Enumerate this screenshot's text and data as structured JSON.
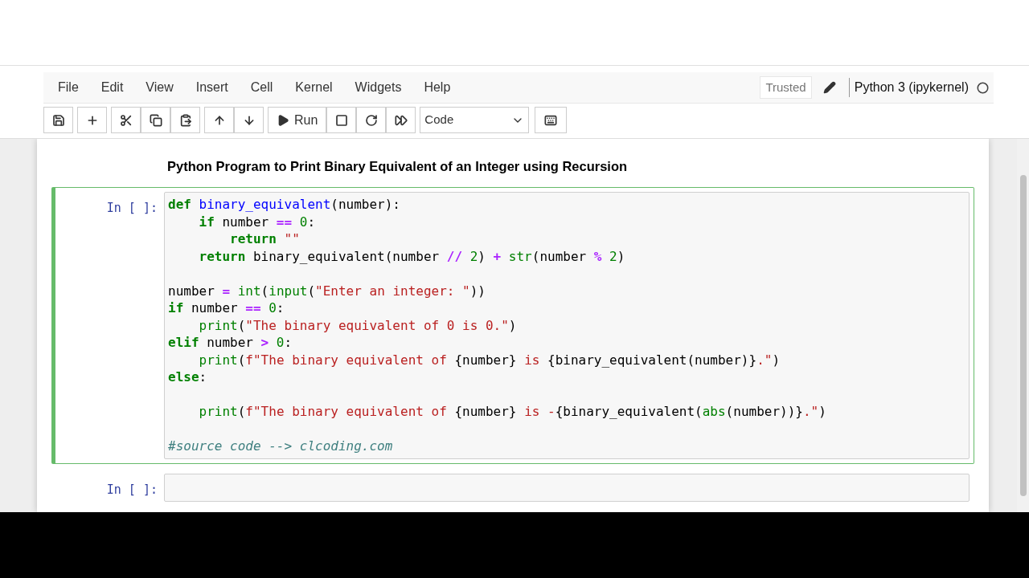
{
  "menu": [
    "File",
    "Edit",
    "View",
    "Insert",
    "Cell",
    "Kernel",
    "Widgets",
    "Help"
  ],
  "trusted": "Trusted",
  "kernel": "Python 3 (ipykernel)",
  "toolbar": {
    "run_label": "Run",
    "cell_type": "Code"
  },
  "heading": "Python Program to Print Binary Equivalent of an Integer using Recursion",
  "cells": [
    {
      "prompt": "In [ ]:",
      "selected": true,
      "lines": [
        {
          "kind": "code",
          "tokens": [
            {
              "kind": "kw",
              "text": "def"
            },
            {
              "kind": "def",
              "text": " binary_equivalent"
            },
            {
              "kind": "plain",
              "text": "(number):"
            }
          ]
        },
        {
          "kind": "code",
          "tokens": [
            {
              "kind": "kw",
              "text": "    if"
            },
            {
              "kind": "plain",
              "text": " number "
            },
            {
              "kind": "op",
              "text": "=="
            },
            {
              "kind": "num",
              "text": " 0"
            },
            {
              "kind": "plain",
              "text": ":"
            }
          ]
        },
        {
          "kind": "code",
          "tokens": [
            {
              "kind": "kw",
              "text": "        return"
            },
            {
              "kind": "str",
              "text": " \"\""
            }
          ]
        },
        {
          "kind": "code",
          "tokens": [
            {
              "kind": "kw",
              "text": "    return"
            },
            {
              "kind": "plain",
              "text": " binary_equivalent(number "
            },
            {
              "kind": "op",
              "text": "//"
            },
            {
              "kind": "num",
              "text": " 2"
            },
            {
              "kind": "plain",
              "text": ") "
            },
            {
              "kind": "op",
              "text": "+"
            },
            {
              "kind": "builtin",
              "text": " str"
            },
            {
              "kind": "plain",
              "text": "(number "
            },
            {
              "kind": "op",
              "text": "%"
            },
            {
              "kind": "num",
              "text": " 2"
            },
            {
              "kind": "plain",
              "text": ")"
            }
          ]
        },
        {
          "kind": "blank"
        },
        {
          "kind": "code",
          "tokens": [
            {
              "kind": "plain",
              "text": "number "
            },
            {
              "kind": "op",
              "text": "="
            },
            {
              "kind": "builtin",
              "text": " int"
            },
            {
              "kind": "plain",
              "text": "("
            },
            {
              "kind": "builtin",
              "text": "input"
            },
            {
              "kind": "plain",
              "text": "("
            },
            {
              "kind": "str",
              "text": "\"Enter an integer: \""
            },
            {
              "kind": "plain",
              "text": "))"
            }
          ]
        },
        {
          "kind": "code",
          "tokens": [
            {
              "kind": "kw",
              "text": "if"
            },
            {
              "kind": "plain",
              "text": " number "
            },
            {
              "kind": "op",
              "text": "=="
            },
            {
              "kind": "num",
              "text": " 0"
            },
            {
              "kind": "plain",
              "text": ":"
            }
          ]
        },
        {
          "kind": "code",
          "tokens": [
            {
              "kind": "builtin",
              "text": "    print"
            },
            {
              "kind": "plain",
              "text": "("
            },
            {
              "kind": "str",
              "text": "\"The binary equivalent of 0 is 0.\""
            },
            {
              "kind": "plain",
              "text": ")"
            }
          ]
        },
        {
          "kind": "code",
          "tokens": [
            {
              "kind": "kw",
              "text": "elif"
            },
            {
              "kind": "plain",
              "text": " number "
            },
            {
              "kind": "op",
              "text": ">"
            },
            {
              "kind": "num",
              "text": " 0"
            },
            {
              "kind": "plain",
              "text": ":"
            }
          ]
        },
        {
          "kind": "code",
          "tokens": [
            {
              "kind": "builtin",
              "text": "    print"
            },
            {
              "kind": "plain",
              "text": "("
            },
            {
              "kind": "str",
              "text": "f\"The binary equivalent of "
            },
            {
              "kind": "plain",
              "text": "{number}"
            },
            {
              "kind": "str",
              "text": " is "
            },
            {
              "kind": "plain",
              "text": "{binary_equivalent(number)}"
            },
            {
              "kind": "str",
              "text": ".\""
            },
            {
              "kind": "plain",
              "text": ")"
            }
          ]
        },
        {
          "kind": "code",
          "tokens": [
            {
              "kind": "kw",
              "text": "else"
            },
            {
              "kind": "plain",
              "text": ":"
            }
          ]
        },
        {
          "kind": "blank"
        },
        {
          "kind": "code",
          "tokens": [
            {
              "kind": "builtin",
              "text": "    print"
            },
            {
              "kind": "plain",
              "text": "("
            },
            {
              "kind": "str",
              "text": "f\"The binary equivalent of "
            },
            {
              "kind": "plain",
              "text": "{number}"
            },
            {
              "kind": "str",
              "text": " is -"
            },
            {
              "kind": "plain",
              "text": "{binary_equivalent("
            },
            {
              "kind": "builtin",
              "text": "abs"
            },
            {
              "kind": "plain",
              "text": "(number))}"
            },
            {
              "kind": "str",
              "text": ".\""
            },
            {
              "kind": "plain",
              "text": ")"
            }
          ]
        },
        {
          "kind": "blank"
        },
        {
          "kind": "code",
          "tokens": [
            {
              "kind": "comment",
              "text": "#source code --> clcoding.com"
            }
          ]
        }
      ]
    },
    {
      "prompt": "In [ ]:",
      "selected": false
    }
  ]
}
